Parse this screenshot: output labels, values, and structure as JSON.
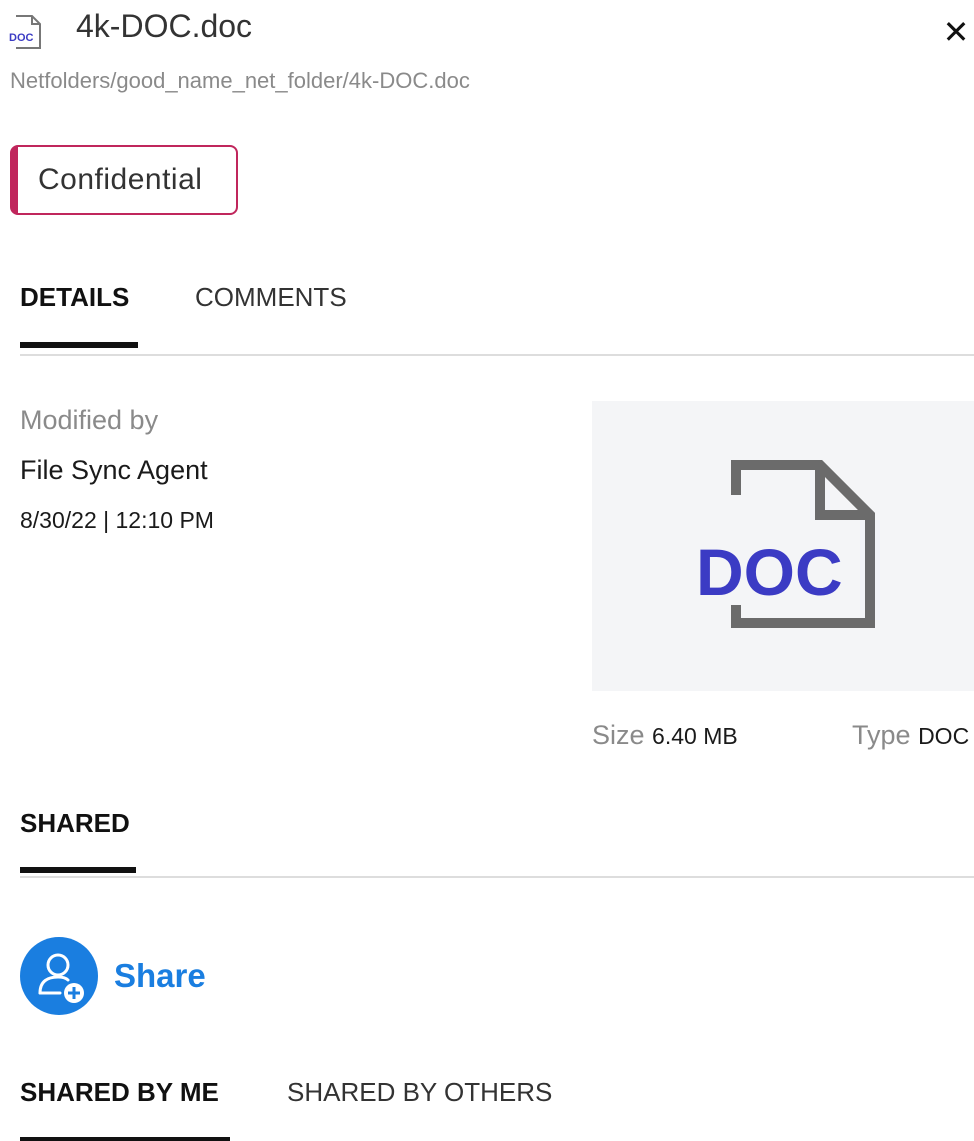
{
  "header": {
    "file_name": "4k-DOC.doc",
    "file_icon_label": "DOC",
    "close_label": "✕",
    "path": "Netfolders/good_name_net_folder/4k-DOC.doc"
  },
  "classification": {
    "label": "Confidential",
    "color": "#c0265c"
  },
  "tabs": [
    {
      "label": "DETAILS",
      "active": true
    },
    {
      "label": "COMMENTS",
      "active": false
    }
  ],
  "details": {
    "modified_by_label": "Modified by",
    "modified_by": "File Sync Agent",
    "modified_date": "8/30/22 | 12:10 PM",
    "preview_label": "DOC",
    "size_label": "Size",
    "size_value": "6.40 MB",
    "type_label": "Type",
    "type_value": "DOC"
  },
  "shared": {
    "title": "SHARED",
    "share_button_label": "Share",
    "accent_color": "#1a7ee0",
    "subtabs": [
      {
        "label": "SHARED BY ME",
        "active": true
      },
      {
        "label": "SHARED BY OTHERS",
        "active": false
      }
    ]
  }
}
